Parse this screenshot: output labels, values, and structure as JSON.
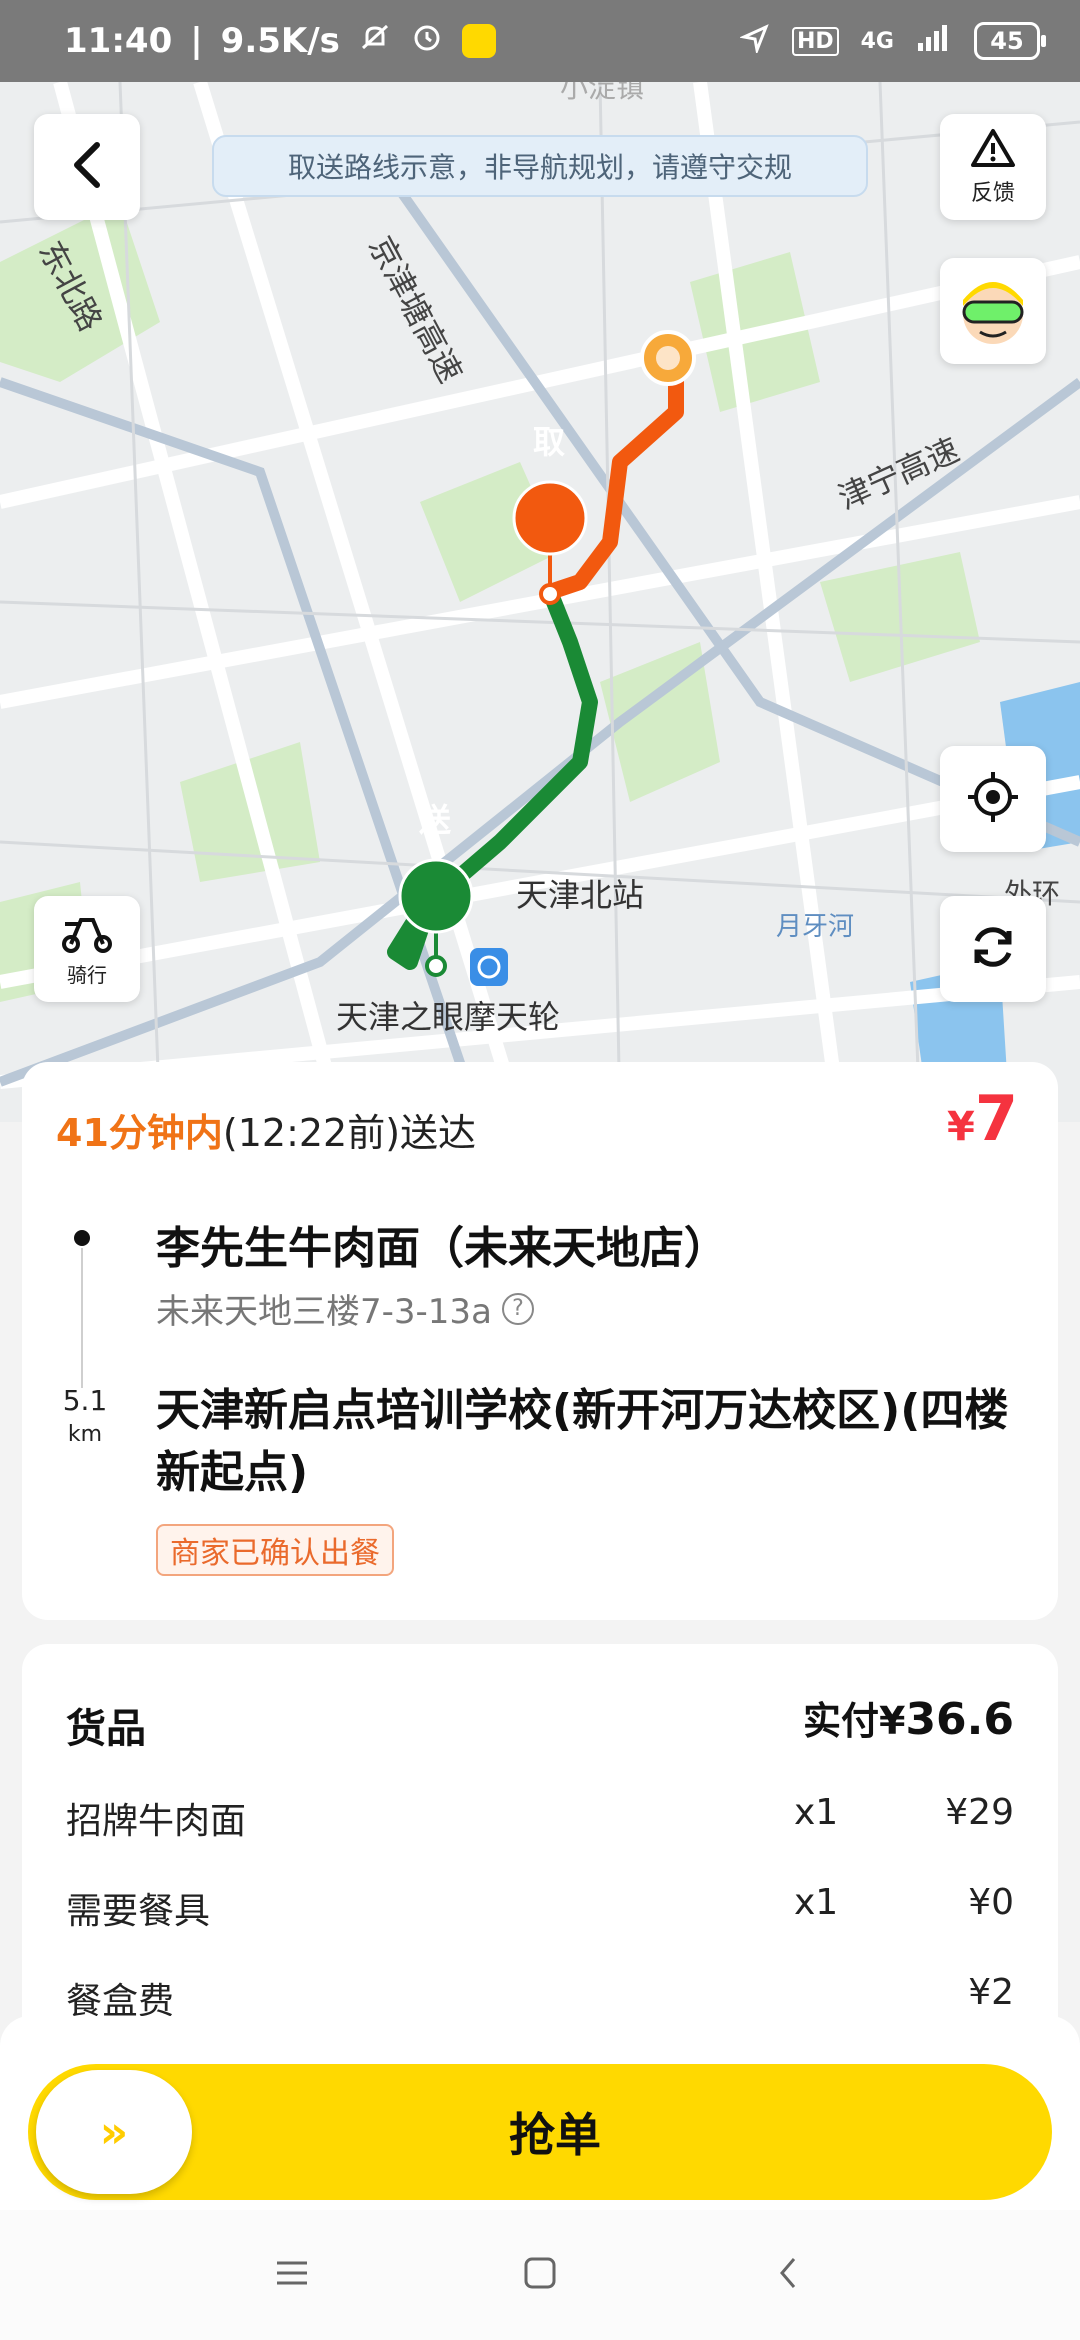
{
  "status_bar": {
    "time": "11:40",
    "net_speed": "9.5K/s",
    "network": "4G",
    "hd": "HD",
    "battery": "45"
  },
  "map": {
    "notice": "取送路线示意，非导航规划，请遵守交规",
    "feedback_label": "反馈",
    "ride_label": "骑行",
    "pickup_marker": "取",
    "dropoff_marker": "送",
    "labels": {
      "station": "天津北站",
      "ferris_wheel": "天津之眼摩天轮",
      "jinning": "津宁高速",
      "jinjitang": "京津塘高速",
      "dongbei_road": "东北路",
      "yueya_river": "月牙河",
      "xiaodian": "小淀镇",
      "waihuan": "外环"
    }
  },
  "order": {
    "eta_highlight": "41分钟内",
    "eta_rest": "(12:22前)送达",
    "price_symbol": "¥",
    "price_value": "7",
    "pickup_name": "李先生牛肉面（未来天地店）",
    "pickup_address": "未来天地三楼7-3-13a",
    "distance_value": "5.1",
    "distance_unit": "km",
    "dropoff_name": "天津新启点培训学校(新开河万达校区)(四楼新起点)",
    "status_tag": "商家已确认出餐"
  },
  "goods": {
    "title": "货品",
    "paid_label": "实付¥",
    "paid_amount": "36.6",
    "items": [
      {
        "name": "招牌牛肉面",
        "qty": "x1",
        "amount": "¥29"
      },
      {
        "name": "需要餐具",
        "qty": "x1",
        "amount": "¥0"
      },
      {
        "name": "餐盒费",
        "qty": "",
        "amount": "¥2"
      }
    ]
  },
  "action": {
    "grab_label": "抢单",
    "knob_glyph": "»"
  },
  "colors": {
    "accent_yellow": "#ffd900",
    "eta_orange": "#f07316",
    "price_red": "#f5333f",
    "route_pickup": "#f2590f",
    "route_dropoff": "#1a8a35"
  }
}
